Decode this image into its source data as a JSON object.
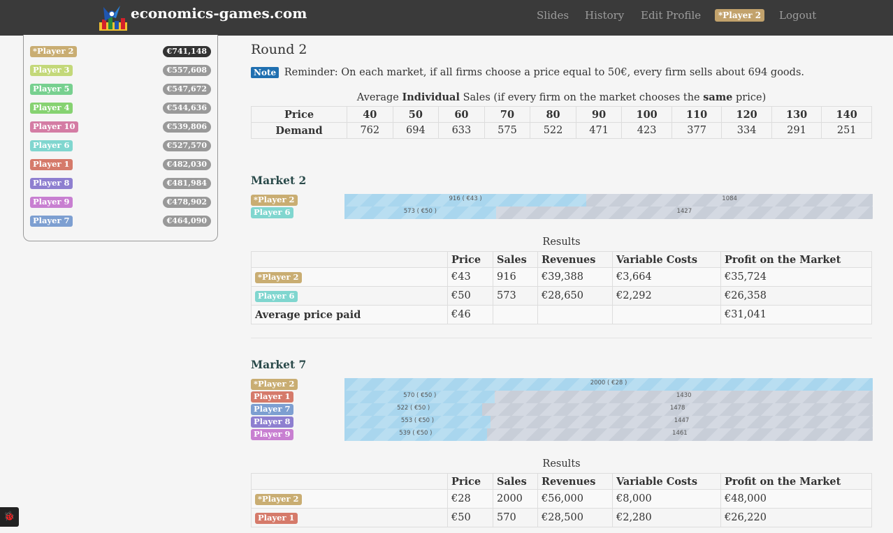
{
  "nav": {
    "brand": "economics-games.com",
    "items": [
      "Slides",
      "History",
      "Edit Profile"
    ],
    "player_badge": "*Player 2",
    "logout": "Logout"
  },
  "ranking": [
    {
      "name": "*Player 2",
      "money": "€741,148",
      "color": "#c9ad72"
    },
    {
      "name": "Player 3",
      "money": "€557,608",
      "color": "#c3d879"
    },
    {
      "name": "Player 5",
      "money": "€547,672",
      "color": "#77d08f"
    },
    {
      "name": "Player 4",
      "money": "€544,636",
      "color": "#86d271"
    },
    {
      "name": "Player 10",
      "money": "€539,806",
      "color": "#d47ca4"
    },
    {
      "name": "Player 6",
      "money": "€527,570",
      "color": "#80d6cf"
    },
    {
      "name": "Player 1",
      "money": "€482,030",
      "color": "#d57a6a"
    },
    {
      "name": "Player 8",
      "money": "€481,984",
      "color": "#8e7fd0"
    },
    {
      "name": "Player 9",
      "money": "€478,902",
      "color": "#c87fd1"
    },
    {
      "name": "Player 7",
      "money": "€464,090",
      "color": "#7d9fd1"
    }
  ],
  "round": {
    "title": "Round 2",
    "note_label": "Note",
    "note_text": "Reminder: On each market, if all firms choose a price equal to 50€, every firm sells about 694 goods."
  },
  "demand": {
    "caption_pre": "Average ",
    "caption_bold1": "Individual",
    "caption_mid": " Sales (if every firm on the market chooses the ",
    "caption_bold2": "same",
    "caption_post": " price)",
    "price_label": "Price",
    "demand_label": "Demand",
    "prices": [
      "40",
      "50",
      "60",
      "70",
      "80",
      "90",
      "100",
      "110",
      "120",
      "130",
      "140"
    ],
    "demands": [
      "762",
      "694",
      "633",
      "575",
      "522",
      "471",
      "423",
      "377",
      "334",
      "291",
      "251"
    ]
  },
  "results_caption": "Results",
  "results_headers": [
    "Price",
    "Sales",
    "Revenues",
    "Variable Costs",
    "Profit on the Market"
  ],
  "markets": [
    {
      "title": "Market 2",
      "bars": [
        {
          "player": "*Player 2",
          "color": "#c9ad72",
          "sold": 916,
          "unsold": 1084,
          "fill_label": "916 ( €43 )",
          "rest_label": "1084"
        },
        {
          "player": "Player 6",
          "color": "#80d6cf",
          "sold": 573,
          "unsold": 1427,
          "fill_label": "573 ( €50 )",
          "rest_label": "1427"
        }
      ],
      "rows": [
        {
          "player": "*Player 2",
          "color": "#c9ad72",
          "price": "€43",
          "sales": "916",
          "revenues": "€39,388",
          "costs": "€3,664",
          "profit": "€35,724"
        },
        {
          "player": "Player 6",
          "color": "#80d6cf",
          "price": "€50",
          "sales": "573",
          "revenues": "€28,650",
          "costs": "€2,292",
          "profit": "€26,358"
        }
      ],
      "avg_label": "Average price paid",
      "avg_price": "€46",
      "avg_profit": "€31,041"
    },
    {
      "title": "Market 7",
      "bars": [
        {
          "player": "*Player 2",
          "color": "#c9ad72",
          "sold": 2000,
          "unsold": 0,
          "fill_label": "2000 ( €28 )",
          "rest_label": ""
        },
        {
          "player": "Player 1",
          "color": "#d57a6a",
          "sold": 570,
          "unsold": 1430,
          "fill_label": "570 ( €50 )",
          "rest_label": "1430"
        },
        {
          "player": "Player 7",
          "color": "#7d9fd1",
          "sold": 522,
          "unsold": 1478,
          "fill_label": "522 ( €50 )",
          "rest_label": "1478"
        },
        {
          "player": "Player 8",
          "color": "#8e7fd0",
          "sold": 553,
          "unsold": 1447,
          "fill_label": "553 ( €50 )",
          "rest_label": "1447"
        },
        {
          "player": "Player 9",
          "color": "#c87fd1",
          "sold": 539,
          "unsold": 1461,
          "fill_label": "539 ( €50 )",
          "rest_label": "1461"
        }
      ],
      "rows": [
        {
          "player": "*Player 2",
          "color": "#c9ad72",
          "price": "€28",
          "sales": "2000",
          "revenues": "€56,000",
          "costs": "€8,000",
          "profit": "€48,000"
        },
        {
          "player": "Player 1",
          "color": "#d57a6a",
          "price": "€50",
          "sales": "570",
          "revenues": "€28,500",
          "costs": "€2,280",
          "profit": "€26,220"
        }
      ]
    }
  ]
}
